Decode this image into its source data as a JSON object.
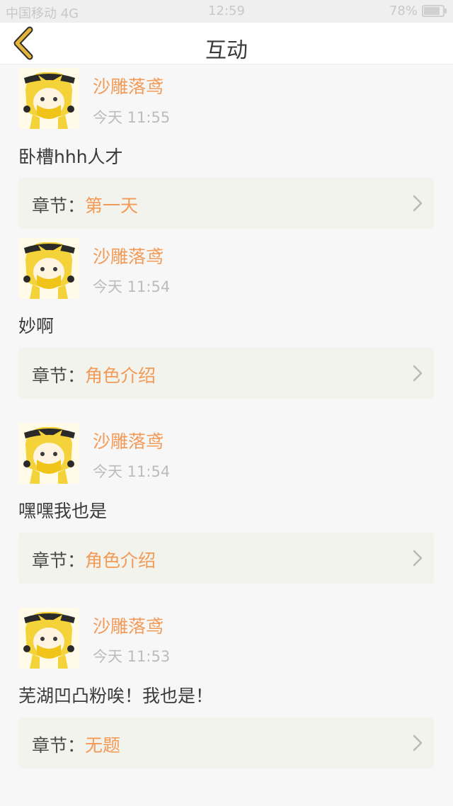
{
  "status_bar": {
    "carrier": "中国移动 4G",
    "time": "12:59",
    "battery": "78%"
  },
  "header": {
    "title": "互动",
    "back_icon": "chevron-left-icon"
  },
  "comments": [
    {
      "user": "沙雕落鸢",
      "time": "今天 11:55",
      "text": "卧槽hhh人才",
      "chapter_label": "章节：",
      "chapter": "第一天"
    },
    {
      "user": "沙雕落鸢",
      "time": "今天 11:54",
      "text": "妙啊",
      "chapter_label": "章节：",
      "chapter": "角色介绍"
    },
    {
      "user": "沙雕落鸢",
      "time": "今天 11:54",
      "text": "嘿嘿我也是",
      "chapter_label": "章节：",
      "chapter": "角色介绍"
    },
    {
      "user": "沙雕落鸢",
      "time": "今天 11:53",
      "text": "芜湖凹凸粉唉！我也是！",
      "chapter_label": "章节：",
      "chapter": "无题"
    }
  ],
  "colors": {
    "accent": "#f29a56",
    "back_icon": "#e5b43b"
  }
}
